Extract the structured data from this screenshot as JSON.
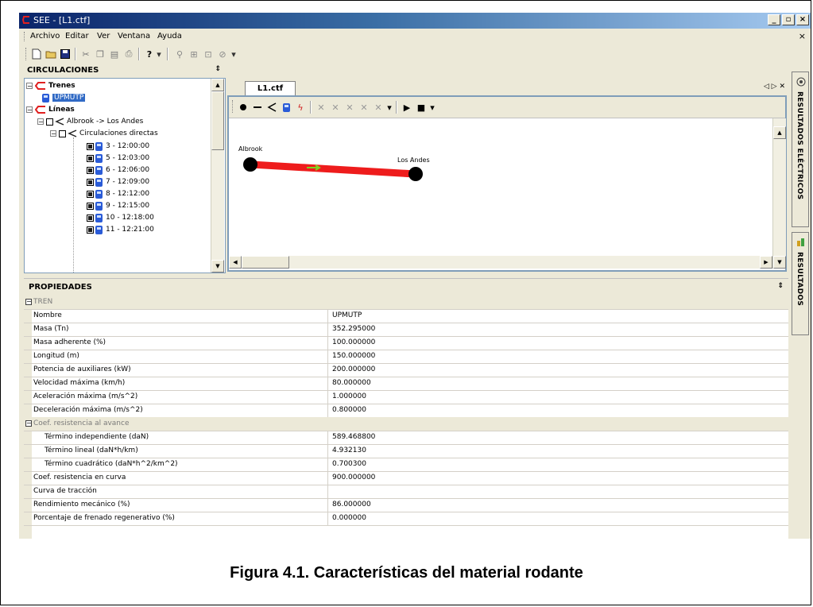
{
  "window": {
    "title": "SEE - [L1.ctf]"
  },
  "menu": {
    "items": [
      "Archivo",
      "Editar",
      "Ver",
      "Ventana",
      "Ayuda"
    ],
    "close": "×"
  },
  "tree": {
    "title": "CIRCULACIONES",
    "pin": "⇕",
    "trenes_label": "Trenes",
    "train_unit": "UPMUTP",
    "lineas_label": "Líneas",
    "line_label": "Albrook -> Los Andes",
    "circ_label": "Circulaciones directas",
    "circulations": [
      "3 - 12:00:00",
      "5 - 12:03:00",
      "6 - 12:06:00",
      "7 - 12:09:00",
      "8 - 12:12:00",
      "9 - 12:15:00",
      "10 - 12:18:00",
      "11 - 12:21:00"
    ]
  },
  "document": {
    "tab": "L1.ctf",
    "nav": "◁ ▷ ✕",
    "station_left": "Albrook",
    "station_right": "Los Andes"
  },
  "sidetabs": {
    "electric": "RESULTADOS ELÉCTRICOS",
    "results": "RESULTADOS"
  },
  "properties": {
    "title": "PROPIEDADES",
    "pin": "⇕",
    "category": "TREN",
    "rows": [
      {
        "label": "Nombre",
        "value": "UPMUTP"
      },
      {
        "label": "Masa (Tn)",
        "value": "352.295000"
      },
      {
        "label": "Masa adherente (%)",
        "value": "100.000000"
      },
      {
        "label": "Longitud (m)",
        "value": "150.000000"
      },
      {
        "label": "Potencia de auxiliares (kW)",
        "value": "200.000000"
      },
      {
        "label": "Velocidad máxima (km/h)",
        "value": "80.000000"
      },
      {
        "label": "Aceleración máxima (m/s^2)",
        "value": "1.000000"
      },
      {
        "label": "Deceleración máxima (m/s^2)",
        "value": "0.800000"
      }
    ],
    "subcategory": "Coef. resistencia al avance",
    "subrows": [
      {
        "label": "Término independiente (daN)",
        "value": "589.468800"
      },
      {
        "label": "Término lineal (daN*h/km)",
        "value": "4.932130"
      },
      {
        "label": "Término cuadrático (daN*h^2/km^2)",
        "value": "0.700300"
      }
    ],
    "rows2": [
      {
        "label": "Coef. resistencia en curva",
        "value": "900.000000"
      },
      {
        "label": "Curva de tracción",
        "value": ""
      },
      {
        "label": "Rendimiento mecánico (%)",
        "value": "86.000000"
      },
      {
        "label": "Porcentaje de frenado regenerativo (%)",
        "value": "0.000000"
      }
    ]
  },
  "caption": "Figura 4.1. Características del material rodante",
  "colors": {
    "titlebar": "#0a246a",
    "track": "#ee1c1c",
    "arrow": "#7fd321",
    "train_icon": "#2a5bd7"
  }
}
